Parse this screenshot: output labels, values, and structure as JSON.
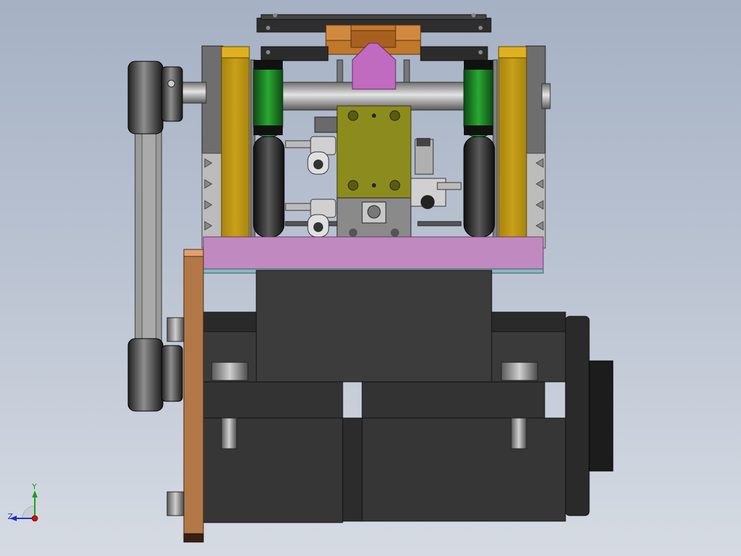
{
  "viewport": {
    "background_top": "#a5b1c4",
    "background_bottom": "#d6dbe3"
  },
  "colors": {
    "motor_body": "#3c3c3c",
    "bracket_gold": "#c8a018",
    "wheel_green": "#1f8a2a",
    "slider_magenta": "#c06ac0",
    "base_plate_pink": "#c08ac0",
    "block_olive": "#8c8c1e",
    "copper_block": "#c0782a",
    "side_plate_copper": "#b27848",
    "belt_gray": "#9a9a9a"
  },
  "triad": {
    "axis_y": "Y",
    "axis_z": "Z",
    "axis_y_color": "#18a018",
    "axis_z_color": "#2030c8",
    "origin_color": "#d01010"
  }
}
